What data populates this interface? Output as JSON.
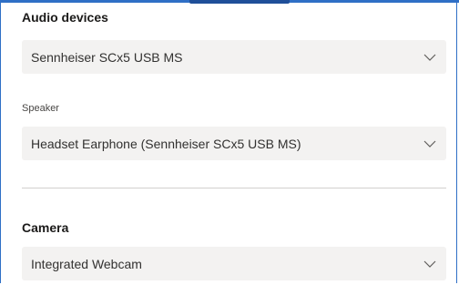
{
  "audio_devices": {
    "heading": "Audio devices",
    "microphone": {
      "value": "Sennheiser SCx5 USB MS"
    },
    "speaker": {
      "label": "Speaker",
      "value": "Headset Earphone (Sennheiser SCx5 USB MS)"
    }
  },
  "camera": {
    "heading": "Camera",
    "device": {
      "value": "Integrated Webcam"
    }
  },
  "icons": {
    "dropdown_chevron": "chevron-down-icon"
  },
  "colors": {
    "frame_border": "#2f6fc6",
    "dropdown_bg": "#f3f2f1",
    "divider": "#d2d0ce"
  }
}
